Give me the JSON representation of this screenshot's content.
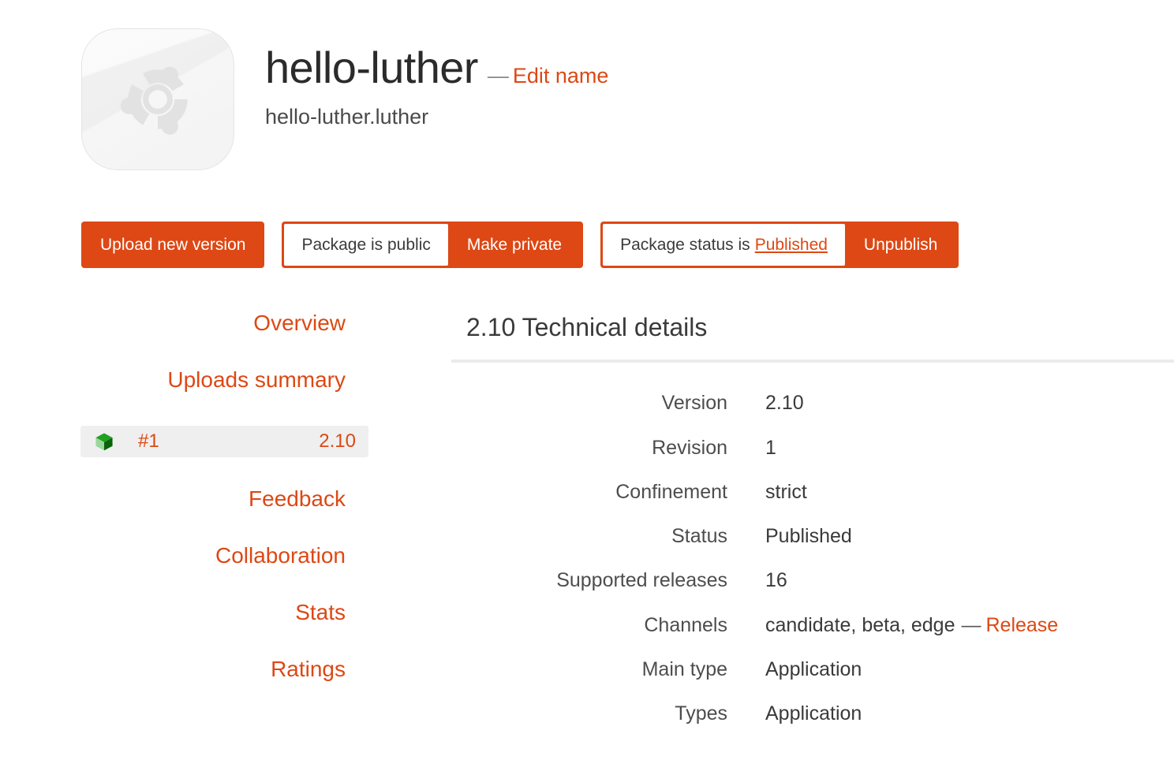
{
  "header": {
    "icon_name": "ubuntu-circle-of-friends",
    "package_title": "hello-luther",
    "title_separator": "—",
    "edit_name_label": "Edit name",
    "package_id": "hello-luther.luther"
  },
  "actions": {
    "upload_label": "Upload new version",
    "visibility_status_label": "Package is public",
    "visibility_toggle_label": "Make private",
    "status_prefix_label": "Package status is",
    "status_value_label": "Published",
    "status_toggle_label": "Unpublish"
  },
  "sidebar": {
    "items": [
      {
        "label": "Overview"
      },
      {
        "label": "Uploads summary"
      },
      {
        "label": "Feedback"
      },
      {
        "label": "Collaboration"
      },
      {
        "label": "Stats"
      },
      {
        "label": "Ratings"
      }
    ],
    "revision_entry": {
      "icon_name": "green-cube-icon",
      "number": "#1",
      "version": "2.10"
    }
  },
  "main": {
    "heading": "2.10 Technical details",
    "details": [
      {
        "label": "Version",
        "value": "2.10"
      },
      {
        "label": "Revision",
        "value": "1"
      },
      {
        "label": "Confinement",
        "value": "strict"
      },
      {
        "label": "Status",
        "value": "Published"
      },
      {
        "label": "Supported releases",
        "value": "16"
      },
      {
        "label": "Channels",
        "value": "candidate, beta, edge",
        "dash": "—",
        "link": "Release"
      },
      {
        "label": "Main type",
        "value": "Application"
      },
      {
        "label": "Types",
        "value": "Application"
      }
    ]
  },
  "colors": {
    "accent": "#dd4814",
    "text": "#3a3a3a",
    "muted": "#4d4d4d",
    "rule": "#ebebeb",
    "row_highlight": "#efefef",
    "cube_green": "#1f8a1f"
  }
}
